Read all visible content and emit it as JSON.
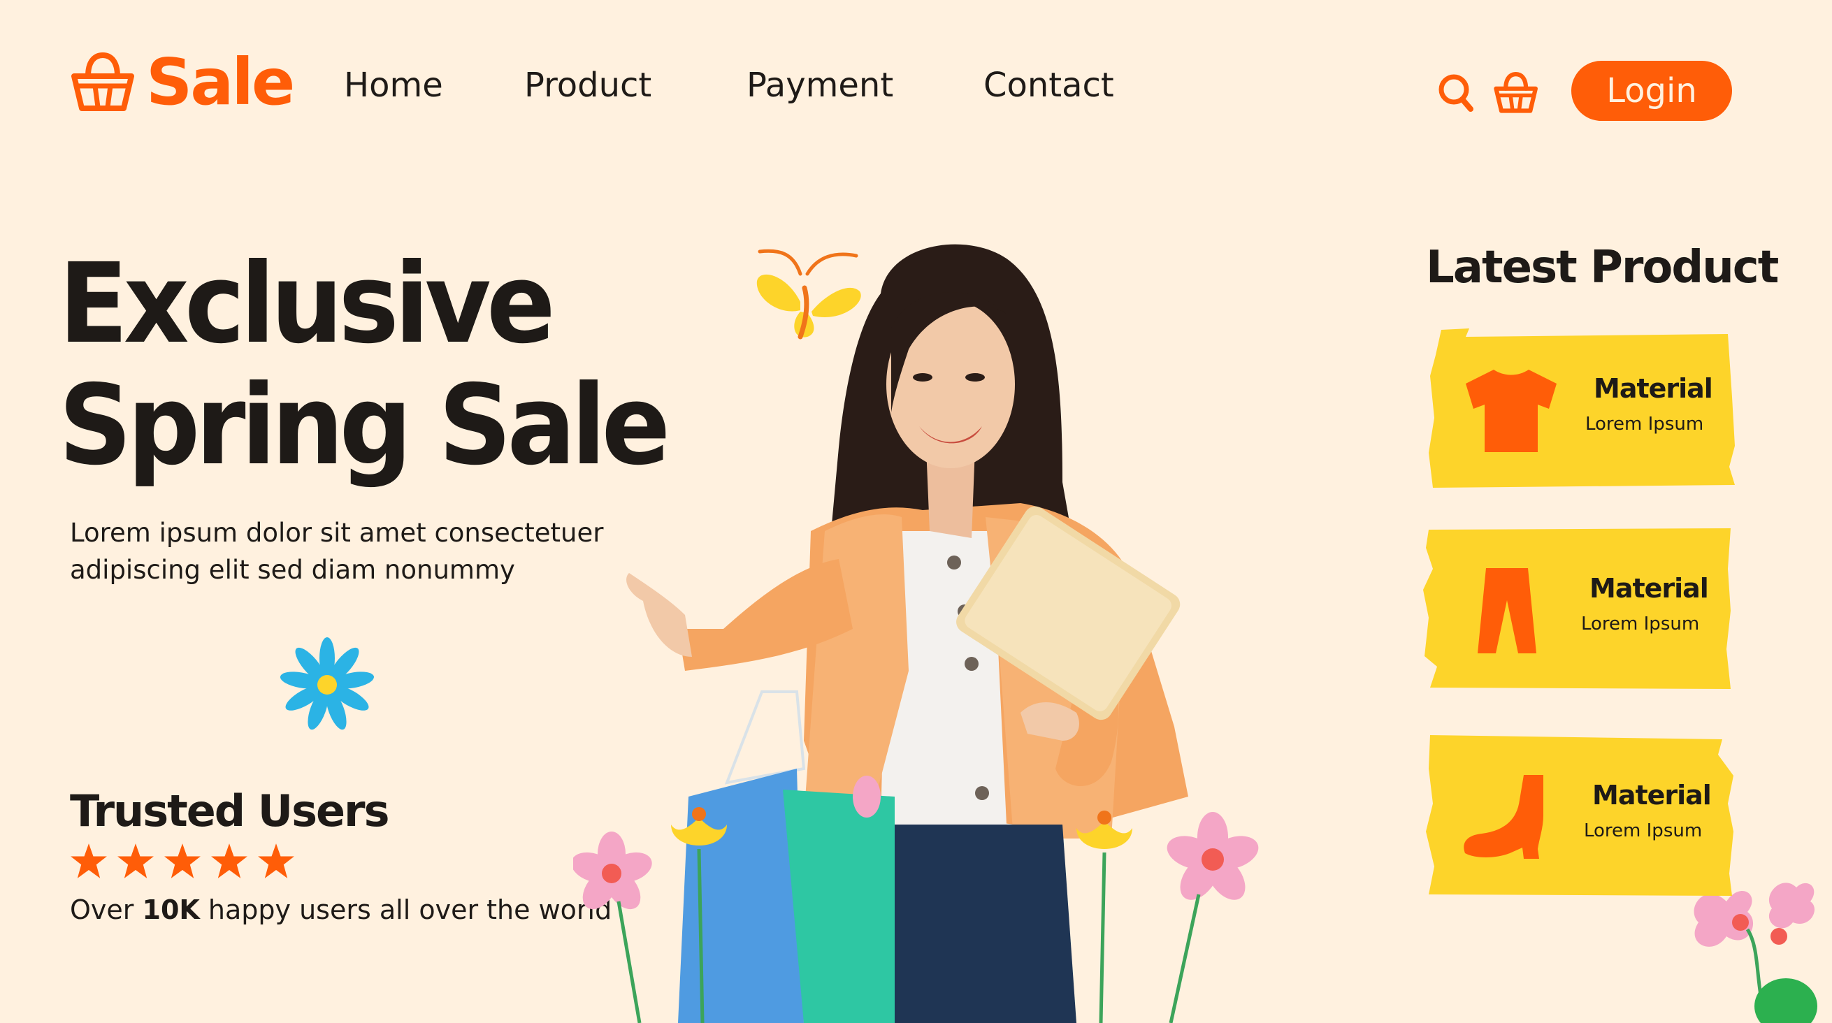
{
  "brand": {
    "name": "Sale",
    "icon": "basket-icon",
    "color": "#FF5D08"
  },
  "nav": [
    {
      "label": "Home"
    },
    {
      "label": "Product"
    },
    {
      "label": "Payment"
    },
    {
      "label": "Contact"
    }
  ],
  "header": {
    "search_icon": "search-icon",
    "cart_icon": "basket-icon",
    "login_label": "Login"
  },
  "hero": {
    "title_line1": "Exclusive",
    "title_line2": "Spring Sale",
    "description": "Lorem ipsum dolor sit amet consectetuer adipiscing elit sed diam nonummy"
  },
  "trusted": {
    "title": "Trusted Users",
    "rating": 5,
    "desc_prefix": "Over",
    "desc_highlight": "10K",
    "desc_suffix": "happy users all over the world"
  },
  "latest": {
    "title": "Latest Product",
    "items": [
      {
        "icon": "tshirt-icon",
        "title": "Material",
        "subtitle": "Lorem Ipsum"
      },
      {
        "icon": "pants-icon",
        "title": "Material",
        "subtitle": "Lorem Ipsum"
      },
      {
        "icon": "boot-icon",
        "title": "Material",
        "subtitle": "Lorem Ipsum"
      }
    ]
  },
  "colors": {
    "background": "#FFF1DF",
    "accent": "#FF5D08",
    "card": "#FDD42A",
    "text": "#1E1A17"
  }
}
